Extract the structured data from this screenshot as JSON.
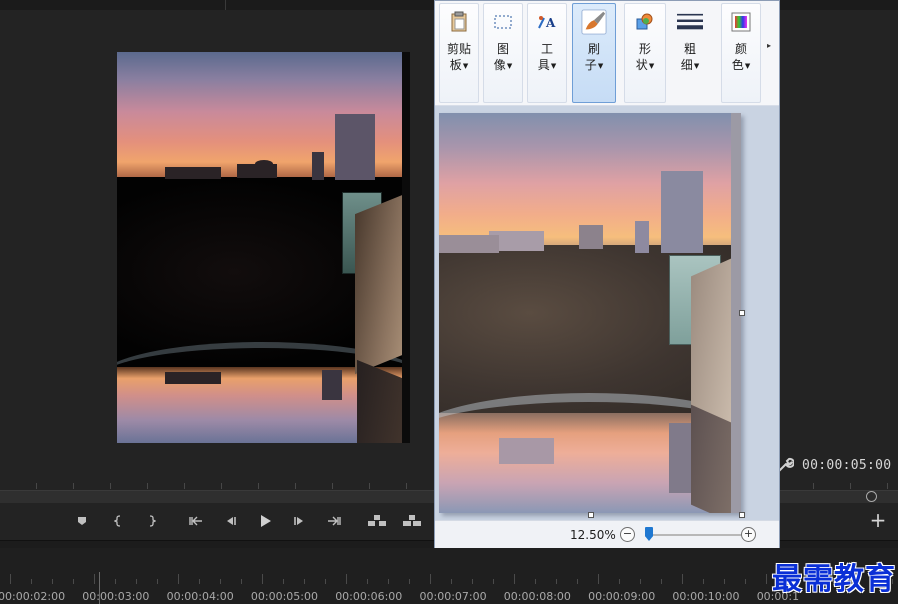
{
  "program_monitor": {
    "timecode": "00:00:05:00"
  },
  "playback_controls": [
    {
      "name": "add-marker-button",
      "icon": "marker-icon"
    },
    {
      "name": "mark-in-button",
      "icon": "mark-in-icon"
    },
    {
      "name": "mark-out-button",
      "icon": "mark-out-icon"
    },
    {
      "name": "go-to-in-button",
      "icon": "go-to-in-icon"
    },
    {
      "name": "step-back-button",
      "icon": "step-back-icon"
    },
    {
      "name": "play-button",
      "icon": "play-icon"
    },
    {
      "name": "step-forward-button",
      "icon": "step-forward-icon"
    },
    {
      "name": "go-to-out-button",
      "icon": "go-to-out-icon"
    },
    {
      "name": "lift-button",
      "icon": "lift-icon"
    },
    {
      "name": "extract-button",
      "icon": "extract-icon"
    }
  ],
  "timeline": {
    "labels": [
      "00:00:02:00",
      "00:00:03:00",
      "00:00:04:00",
      "00:00:05:00",
      "00:00:06:00",
      "00:00:07:00",
      "00:00:08:00",
      "00:00:09:00",
      "00:00:10:00",
      "00:00:1"
    ]
  },
  "paint": {
    "ribbon": {
      "clipboard": {
        "line1": "剪贴",
        "line2": "板"
      },
      "image": {
        "line1": "图",
        "line2": "像"
      },
      "tools": {
        "line1": "工",
        "line2": "具"
      },
      "brushes": {
        "line1": "刷",
        "line2": "子"
      },
      "shapes": {
        "line1": "形",
        "line2": "状"
      },
      "size": {
        "line1": "粗",
        "line2": "细"
      },
      "colors": {
        "line1": "颜",
        "line2": "色"
      }
    },
    "zoom_label": "12.50%",
    "zoom_level_percent": 12.5
  },
  "watermark": "最需教育",
  "colors": {
    "premiere_bg": "#232323",
    "paint_bg": "#f3f5f9",
    "accent_blue": "#1f78d1",
    "watermark": "#0a2fd6"
  }
}
